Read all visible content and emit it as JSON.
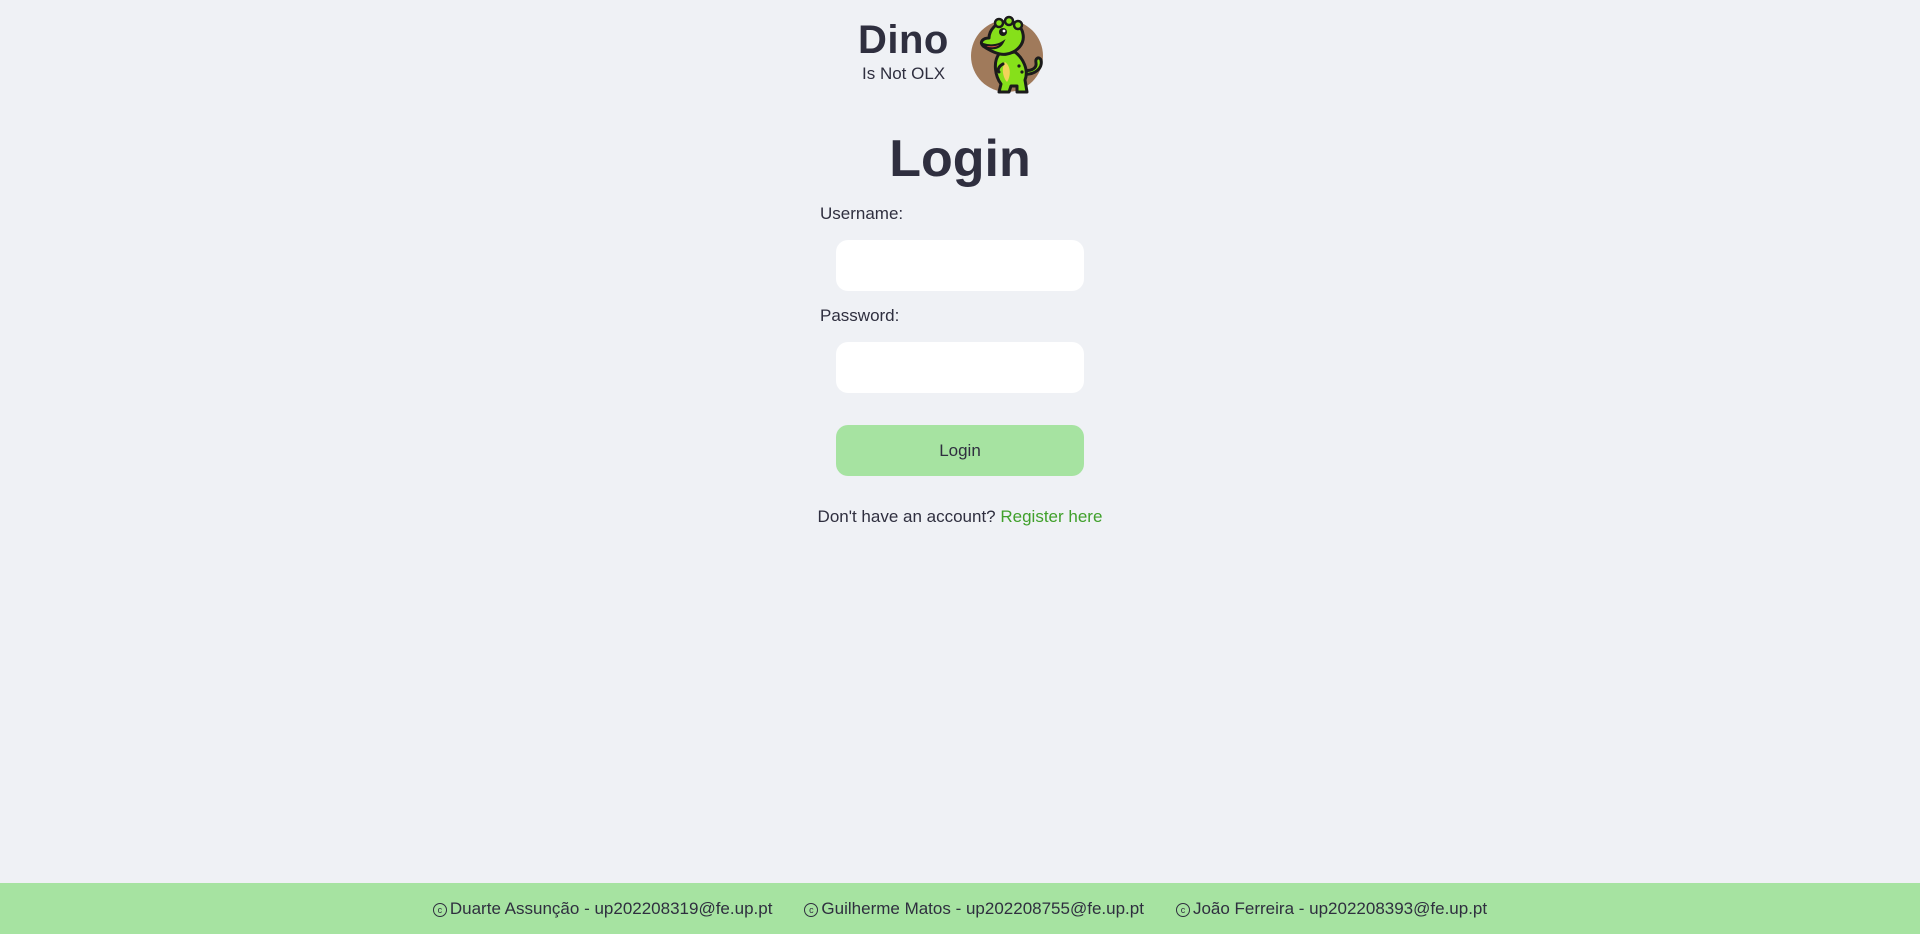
{
  "header": {
    "title": "Dino",
    "subtitle": "Is Not OLX",
    "logo_icon": "dinosaur-icon"
  },
  "main": {
    "heading": "Login",
    "username_label": "Username:",
    "username_value": "",
    "password_label": "Password:",
    "password_value": "",
    "login_button": "Login",
    "register_prompt": "Don't have an account?",
    "register_link": "Register here"
  },
  "footer": {
    "credits": [
      {
        "icon": "copyright-icon",
        "text": "Duarte Assunção - up202208319@fe.up.pt"
      },
      {
        "icon": "copyright-icon",
        "text": "Guilherme Matos - up202208755@fe.up.pt"
      },
      {
        "icon": "copyright-icon",
        "text": "João Ferreira - up202208393@fe.up.pt"
      }
    ]
  },
  "colors": {
    "background": "#eff1f5",
    "text": "#2f2f3f",
    "accent_green": "#a6e3a1",
    "link_green": "#40a02b",
    "input_bg": "#ffffff"
  }
}
